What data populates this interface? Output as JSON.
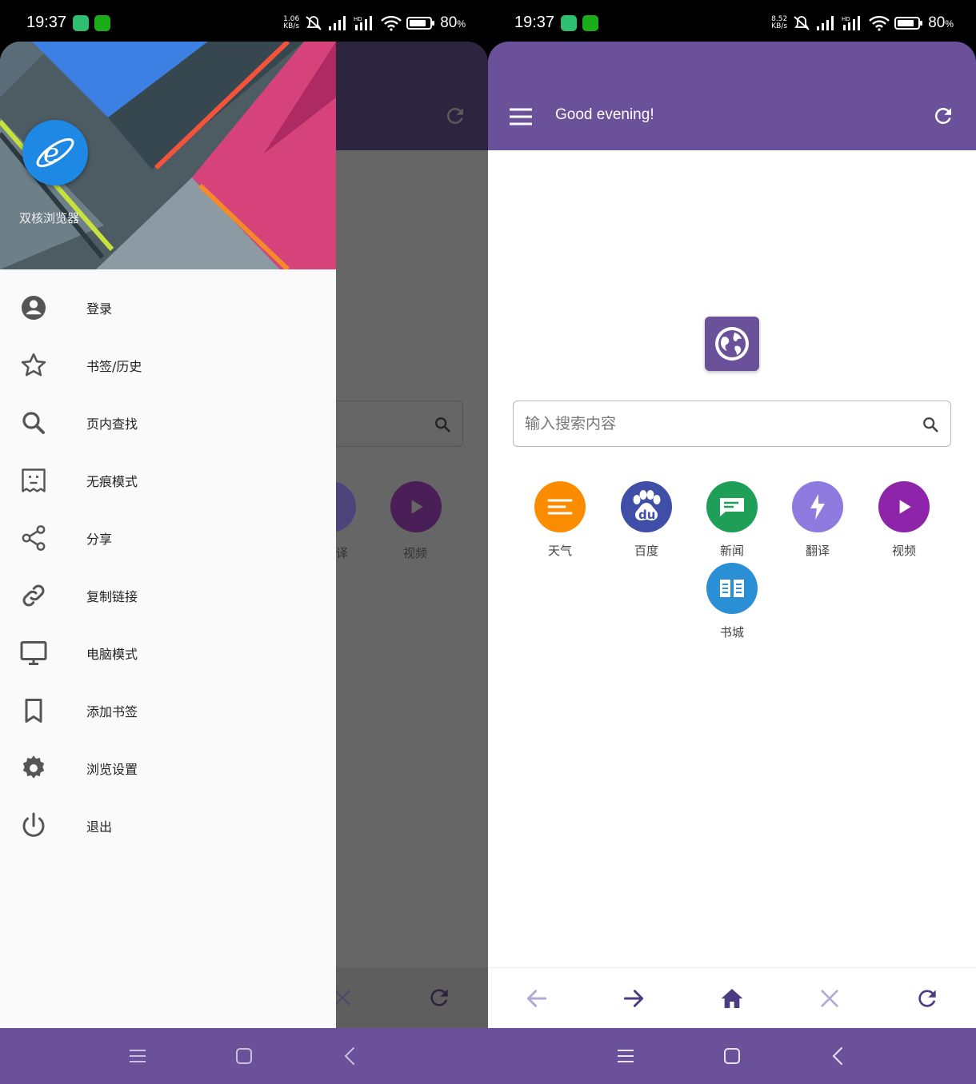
{
  "status_left": {
    "time": "19:37",
    "speed_value": "1.06",
    "speed_unit": "KB/s",
    "battery": "80",
    "battery_unit": "%"
  },
  "status_right": {
    "time": "19:37",
    "speed_value": "8.52",
    "speed_unit": "KB/s",
    "battery": "80",
    "battery_unit": "%"
  },
  "drawer": {
    "app_name": "双核浏览器",
    "items": [
      {
        "label": "登录",
        "icon": "account-circle-icon"
      },
      {
        "label": "书签/历史",
        "icon": "star-icon"
      },
      {
        "label": "页内查找",
        "icon": "search-icon"
      },
      {
        "label": "无痕模式",
        "icon": "incognito-icon"
      },
      {
        "label": "分享",
        "icon": "share-icon"
      },
      {
        "label": "复制链接",
        "icon": "link-icon"
      },
      {
        "label": "电脑模式",
        "icon": "desktop-icon"
      },
      {
        "label": "添加书签",
        "icon": "bookmark-icon"
      },
      {
        "label": "浏览设置",
        "icon": "gear-icon"
      },
      {
        "label": "退出",
        "icon": "power-icon"
      }
    ]
  },
  "dimmed": {
    "partial_label_translate": "译",
    "label_video": "视频"
  },
  "header": {
    "title": "Good evening!"
  },
  "search": {
    "placeholder": "输入搜索内容"
  },
  "shortcuts": [
    {
      "label": "天气",
      "color": "#fb8c00",
      "icon": "weather-icon"
    },
    {
      "label": "百度",
      "color": "#3f4fa8",
      "icon": "baidu-paw-icon",
      "icon_text": "du"
    },
    {
      "label": "新闻",
      "color": "#1e9e57",
      "icon": "news-icon"
    },
    {
      "label": "翻译",
      "color": "#8e7be0",
      "icon": "bolt-icon"
    },
    {
      "label": "视频",
      "color": "#8e24aa",
      "icon": "play-icon"
    },
    {
      "label": "书城",
      "color": "#2b8fd6",
      "icon": "book-icon"
    }
  ],
  "colors": {
    "primary": "#6a519a",
    "nav_active": "#4b3b82",
    "nav_disabled": "#b3a8d8"
  }
}
